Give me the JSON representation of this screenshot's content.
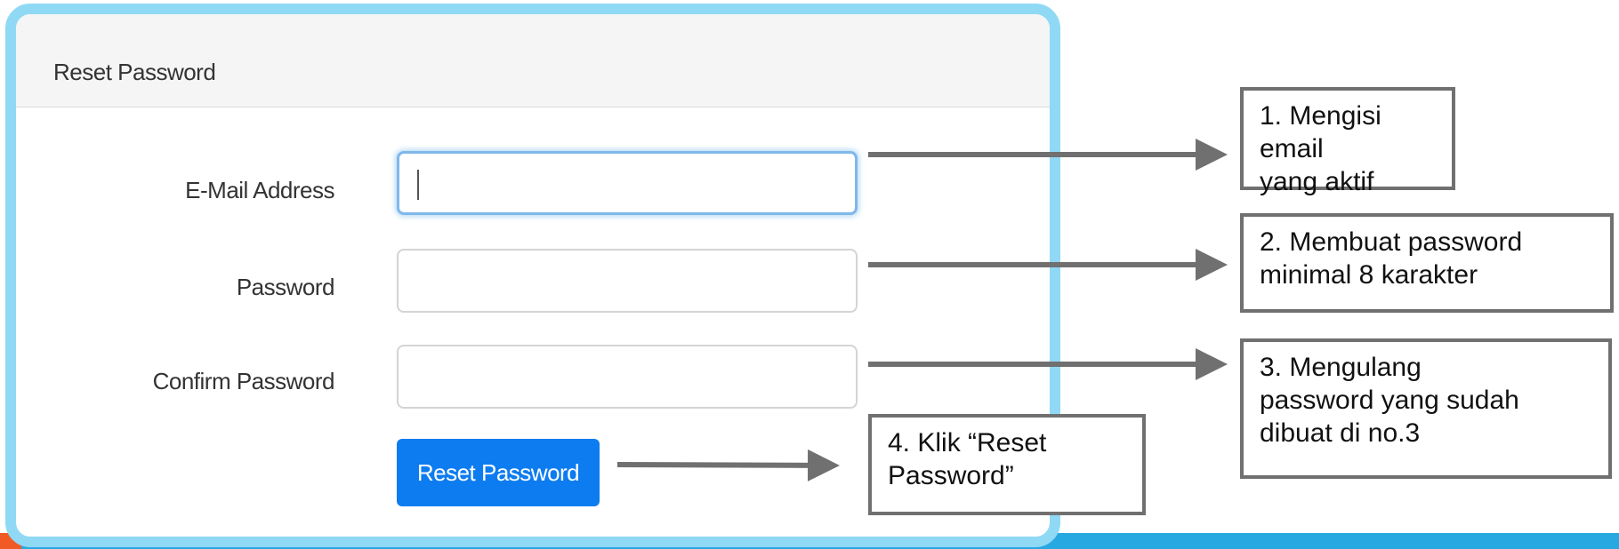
{
  "card": {
    "title": "Reset Password"
  },
  "form": {
    "email_label": "E-Mail Address",
    "email_value": "",
    "password_label": "Password",
    "password_value": "",
    "confirm_label": "Confirm Password",
    "confirm_value": "",
    "submit_label": "Reset Password"
  },
  "annotations": {
    "step1": "1. Mengisi email\nyang aktif",
    "step2": "2. Membuat password\nminimal 8 karakter",
    "step3": "3. Mengulang\npassword yang sudah\ndibuat di no.3",
    "step4": "4. Klik “Reset\nPassword”"
  },
  "colors": {
    "frame_border": "#8fd9f5",
    "button_primary": "#0d7cf0",
    "arrow": "#707070",
    "footer_bar": "#28a8e0",
    "footer_accent": "#f15a24"
  }
}
